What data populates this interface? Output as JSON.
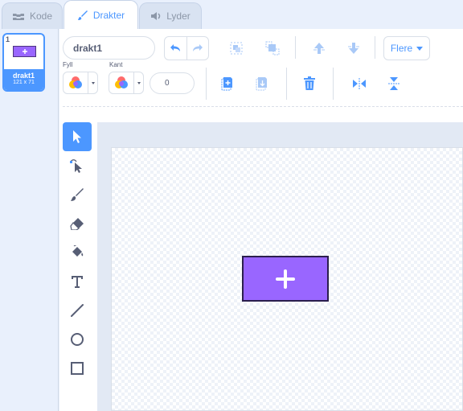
{
  "tabs": [
    {
      "label": "Kode",
      "icon": "code-icon"
    },
    {
      "label": "Drakter",
      "icon": "brush-icon"
    },
    {
      "label": "Lyder",
      "icon": "speaker-icon"
    }
  ],
  "costumes": [
    {
      "number": "1",
      "name": "drakt1",
      "size": "121 x 71"
    }
  ],
  "toolbar": {
    "costume_name": "drakt1",
    "more_label": "Flere",
    "fill_label": "Fyll",
    "outline_label": "Kant",
    "outline_width": "0"
  },
  "colors": {
    "accent": "#4c97ff",
    "costume_fill": "#9966ff",
    "costume_outline": "#2b1f4d"
  },
  "tools": [
    "select-icon",
    "reshape-icon",
    "brush-icon",
    "eraser-icon",
    "fill-icon",
    "text-icon",
    "line-icon",
    "circle-icon",
    "rectangle-icon"
  ]
}
